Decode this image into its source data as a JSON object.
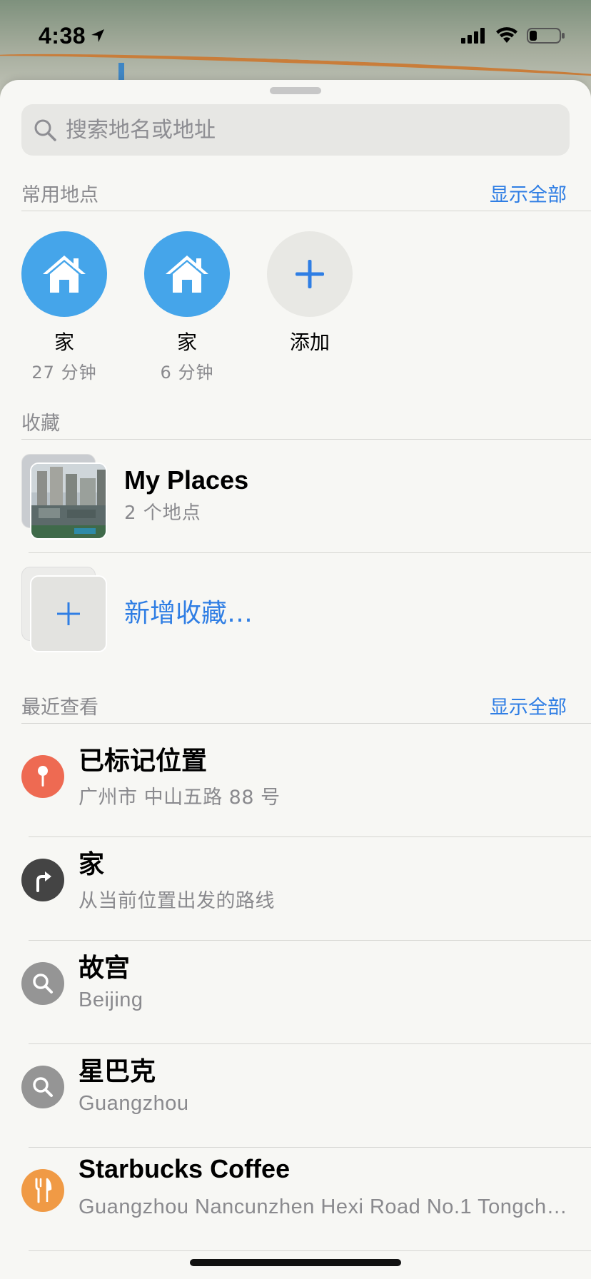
{
  "status": {
    "time": "4:38"
  },
  "search": {
    "placeholder": "搜索地名或地址"
  },
  "favorites": {
    "title": "常用地点",
    "show_all": "显示全部",
    "items": [
      {
        "name": "家",
        "sub": "27 分钟",
        "icon": "house-icon",
        "color": "#45a5ea"
      },
      {
        "name": "家",
        "sub": "6 分钟",
        "icon": "house-icon",
        "color": "#45a5ea"
      },
      {
        "name": "添加",
        "sub": "",
        "icon": "plus-icon",
        "color": "#e8e8e4"
      }
    ]
  },
  "collections": {
    "title": "收藏",
    "items": [
      {
        "title": "My Places",
        "sub": "2 个地点"
      }
    ],
    "new_label": "新增收藏…"
  },
  "recents": {
    "title": "最近查看",
    "show_all": "显示全部",
    "items": [
      {
        "title": "已标记位置",
        "sub": "广州市 中山五路 88 号",
        "icon": "pin-icon",
        "color": "#ee6a52"
      },
      {
        "title": "家",
        "sub": "从当前位置出发的路线",
        "icon": "directions-icon",
        "color": "#444444"
      },
      {
        "title": "故宫",
        "sub": "Beijing",
        "icon": "search-icon",
        "color": "#959595"
      },
      {
        "title": "星巴克",
        "sub": "Guangzhou",
        "icon": "search-icon",
        "color": "#959595"
      },
      {
        "title": "Starbucks Coffee",
        "sub": "Guangzhou Nancunzhen Hexi Road No.1 Tongch…",
        "icon": "fork-knife-icon",
        "color": "#f09a45"
      }
    ]
  },
  "colors": {
    "accent": "#2f7ee4",
    "sheet": "#f7f7f4"
  }
}
